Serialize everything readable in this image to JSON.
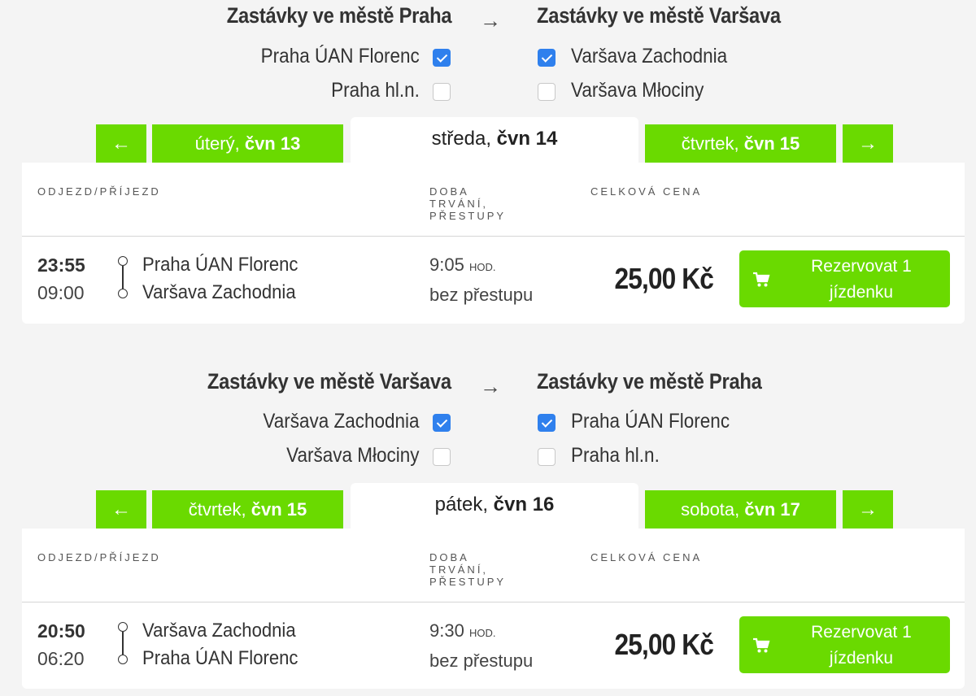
{
  "sections": [
    {
      "from_title": "Zastávky ve městě Praha",
      "to_title": "Zastávky ve městě Varšava",
      "arrow": "→",
      "from_stops": [
        {
          "label": "Praha ÚAN Florenc",
          "checked": true
        },
        {
          "label": "Praha hl.n.",
          "checked": false
        }
      ],
      "to_stops": [
        {
          "label": "Varšava Zachodnia",
          "checked": true
        },
        {
          "label": "Varšava Młociny",
          "checked": false
        }
      ],
      "nav_prev": "←",
      "nav_next": "→",
      "prev_day": {
        "weekday": "úterý,",
        "date": "čvn 13"
      },
      "active_day": {
        "weekday": "středa,",
        "date": "čvn 14"
      },
      "next_day": {
        "weekday": "čtvrtek,",
        "date": "čvn 15"
      },
      "columns": {
        "departure": "ODJEZD/PŘÍJEZD",
        "duration": [
          "DOBA",
          "TRVÁNÍ,",
          "PŘESTUPY"
        ],
        "price": "CELKOVÁ CENA"
      },
      "trip": {
        "departure_time": "23:55",
        "arrival_time": "09:00",
        "from_station": "Praha ÚAN Florenc",
        "to_station": "Varšava Zachodnia",
        "duration": "9:05",
        "duration_unit": "HOD.",
        "transfers": "bez přestupu",
        "price": "25,00 Kč",
        "book_line1": "Rezervovat 1",
        "book_line2": "jízdenku"
      }
    },
    {
      "from_title": "Zastávky ve městě Varšava",
      "to_title": "Zastávky ve městě Praha",
      "arrow": "→",
      "from_stops": [
        {
          "label": "Varšava Zachodnia",
          "checked": true
        },
        {
          "label": "Varšava Młociny",
          "checked": false
        }
      ],
      "to_stops": [
        {
          "label": "Praha ÚAN Florenc",
          "checked": true
        },
        {
          "label": "Praha hl.n.",
          "checked": false
        }
      ],
      "nav_prev": "←",
      "nav_next": "→",
      "prev_day": {
        "weekday": "čtvrtek,",
        "date": "čvn 15"
      },
      "active_day": {
        "weekday": "pátek,",
        "date": "čvn 16"
      },
      "next_day": {
        "weekday": "sobota,",
        "date": "čvn 17"
      },
      "columns": {
        "departure": "ODJEZD/PŘÍJEZD",
        "duration": [
          "DOBA",
          "TRVÁNÍ,",
          "PŘESTUPY"
        ],
        "price": "CELKOVÁ CENA"
      },
      "trip": {
        "departure_time": "20:50",
        "arrival_time": "06:20",
        "from_station": "Varšava Zachodnia",
        "to_station": "Praha ÚAN Florenc",
        "duration": "9:30",
        "duration_unit": "HOD.",
        "transfers": "bez přestupu",
        "price": "25,00 Kč",
        "book_line1": "Rezervovat 1",
        "book_line2": "jízdenku"
      }
    }
  ],
  "colors": {
    "accent": "#6ada00",
    "checkbox": "#2f80ed",
    "background": "#f4f4f4"
  }
}
